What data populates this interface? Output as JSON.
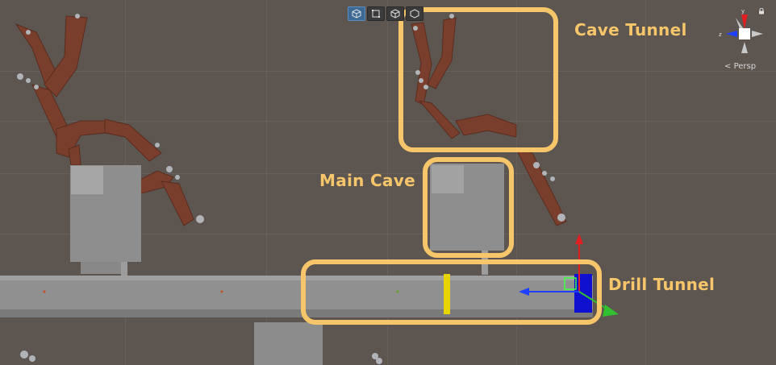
{
  "scene": {
    "callouts": [
      {
        "label": "Cave Tunnel"
      },
      {
        "label": "Main Cave"
      },
      {
        "label": "Drill Tunnel"
      }
    ]
  },
  "toolbar": {
    "tools": [
      "box-select-icon",
      "rect-tool-icon",
      "cube-icon",
      "cube-icon"
    ],
    "active_index": 0
  },
  "orientation_gizmo": {
    "projection_label": "Persp",
    "axis_labels": {
      "y": "y",
      "z": "z"
    }
  },
  "colors": {
    "background": "#5c5550",
    "callout": "#f8c66a",
    "cave_brown": "#7a3e2c",
    "rock": "#8e8e8e",
    "axis_x": "#e02020",
    "axis_y": "#30c030",
    "axis_z": "#2040ff"
  }
}
